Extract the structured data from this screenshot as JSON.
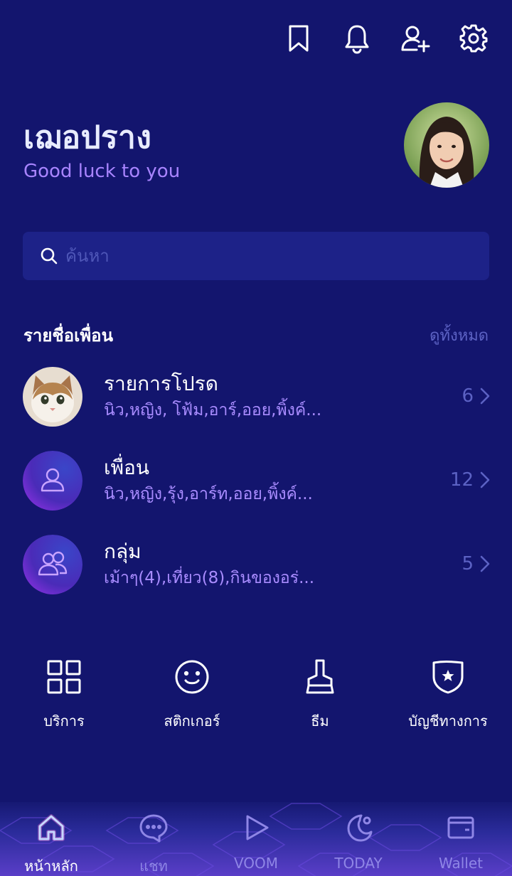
{
  "topbar": {
    "icons": [
      "bookmark-icon",
      "bell-icon",
      "add-friend-icon",
      "gear-icon"
    ]
  },
  "profile": {
    "name": "เฌอปราง",
    "status": "Good luck to you"
  },
  "search": {
    "placeholder": "ค้นหา"
  },
  "friends_section": {
    "title": "รายชื่อเพื่อน",
    "see_all": "ดูทั้งหมด",
    "rows": [
      {
        "title": "รายการโปรด",
        "subtitle": "นิว,หญิง, โฟ้ม,อาร์,ออย,พิ้งค์...",
        "count": "6",
        "icon": "cat-photo"
      },
      {
        "title": "เพื่อน",
        "subtitle": "นิว,หญิง,รุ้ง,อาร์ท,ออย,พิ้งค์...",
        "count": "12",
        "icon": "person-icon"
      },
      {
        "title": "กลุ่ม",
        "subtitle": "เม้าๆ(4),เที่ยว(8),กินของอร่...",
        "count": "5",
        "icon": "group-icon"
      }
    ]
  },
  "shortcuts": [
    {
      "label": "บริการ",
      "icon": "grid-icon"
    },
    {
      "label": "สติกเกอร์",
      "icon": "smiley-icon"
    },
    {
      "label": "ธีม",
      "icon": "brush-icon"
    },
    {
      "label": "บัญชีทางการ",
      "icon": "shield-star-icon"
    }
  ],
  "bottom_nav": {
    "active_index": 0,
    "tabs": [
      {
        "label": "หน้าหลัก",
        "icon": "home-icon"
      },
      {
        "label": "แชท",
        "icon": "chat-icon"
      },
      {
        "label": "VOOM",
        "icon": "play-icon"
      },
      {
        "label": "TODAY",
        "icon": "moon-icon"
      },
      {
        "label": "Wallet",
        "icon": "wallet-icon"
      }
    ]
  },
  "colors": {
    "background": "#13156e",
    "accent": "#a884ff",
    "muted": "#5c62c4",
    "search_bg": "#1d2288"
  }
}
